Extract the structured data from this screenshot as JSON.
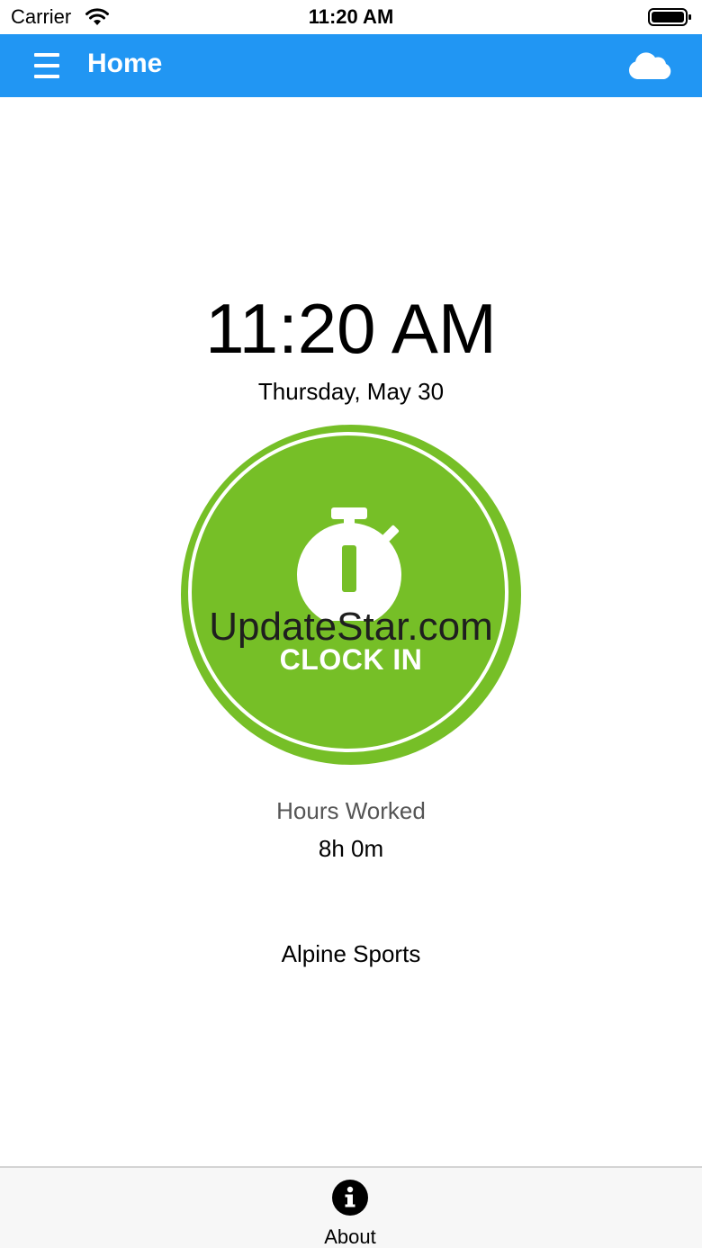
{
  "status_bar": {
    "carrier": "Carrier",
    "time": "11:20 AM"
  },
  "nav": {
    "title": "Home",
    "menu_icon": "hamburger-menu-icon",
    "sync_icon": "cloud-icon",
    "color": "#2196f3"
  },
  "clock": {
    "time": "11:20 AM",
    "date": "Thursday, May 30",
    "button_label": "CLOCK IN",
    "button_icon": "stopwatch-icon",
    "button_color": "#76bf27"
  },
  "watermark": "UpdateStar.com",
  "hours": {
    "label": "Hours Worked",
    "value": "8h 0m"
  },
  "company": "Alpine Sports",
  "tab_bar": {
    "items": [
      {
        "label": "About",
        "icon": "info-icon"
      }
    ]
  }
}
